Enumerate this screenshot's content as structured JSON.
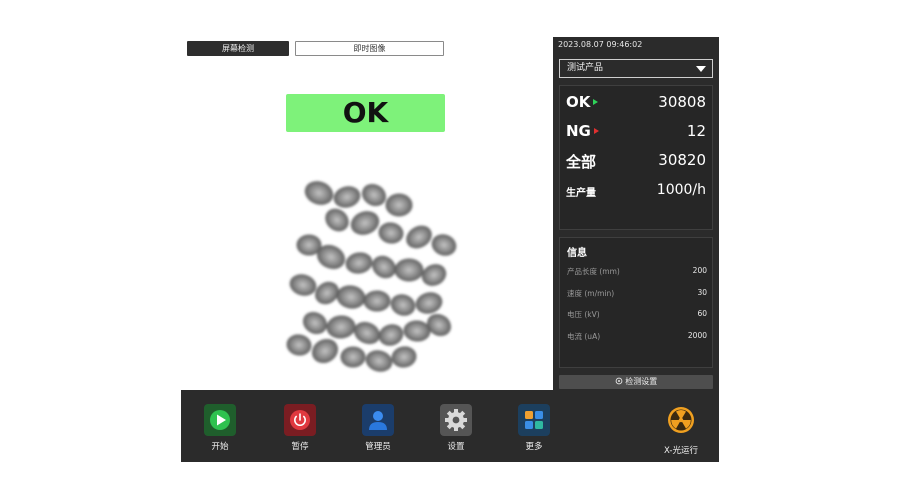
{
  "tabs": {
    "screen_detect": "屏幕检测",
    "live_image": "即时图像"
  },
  "result": {
    "text": "OK",
    "color": "#7ef27a"
  },
  "panel": {
    "datetime": "2023.08.07   09:46:02",
    "product_select": "测试产品",
    "stats": {
      "ok_label": "OK",
      "ok_value": "30808",
      "ng_label": "NG",
      "ng_value": "12",
      "total_label": "全部",
      "total_value": "30820",
      "rate_label": "生产量",
      "rate_value": "1000/h"
    },
    "info": {
      "title": "信息",
      "rows": [
        {
          "label": "产品长度 (mm)",
          "value": "200"
        },
        {
          "label": "速度 (m/min)",
          "value": "30"
        },
        {
          "label": "电压 (kV)",
          "value": "60"
        },
        {
          "label": "电流 (uA)",
          "value": "2000"
        }
      ]
    },
    "detect_settings_button": "检测设置"
  },
  "toolbar": {
    "start": "开始",
    "pause": "暂停",
    "admin": "管理员",
    "settings": "设置",
    "more": "更多",
    "xray_status": "X-光运行"
  },
  "colors": {
    "ok_arrow": "#2fd35a",
    "ng_arrow": "#e03030",
    "start_icon": "#22b14c",
    "pause_icon": "#d9343c",
    "admin_icon": "#1f6ec9",
    "radiation_icon": "#f0a020"
  },
  "icons": [
    "play-icon",
    "power-icon",
    "user-icon",
    "gear-icon",
    "apps-grid-icon",
    "radiation-icon",
    "caret-down-icon",
    "gear-small-icon"
  ]
}
